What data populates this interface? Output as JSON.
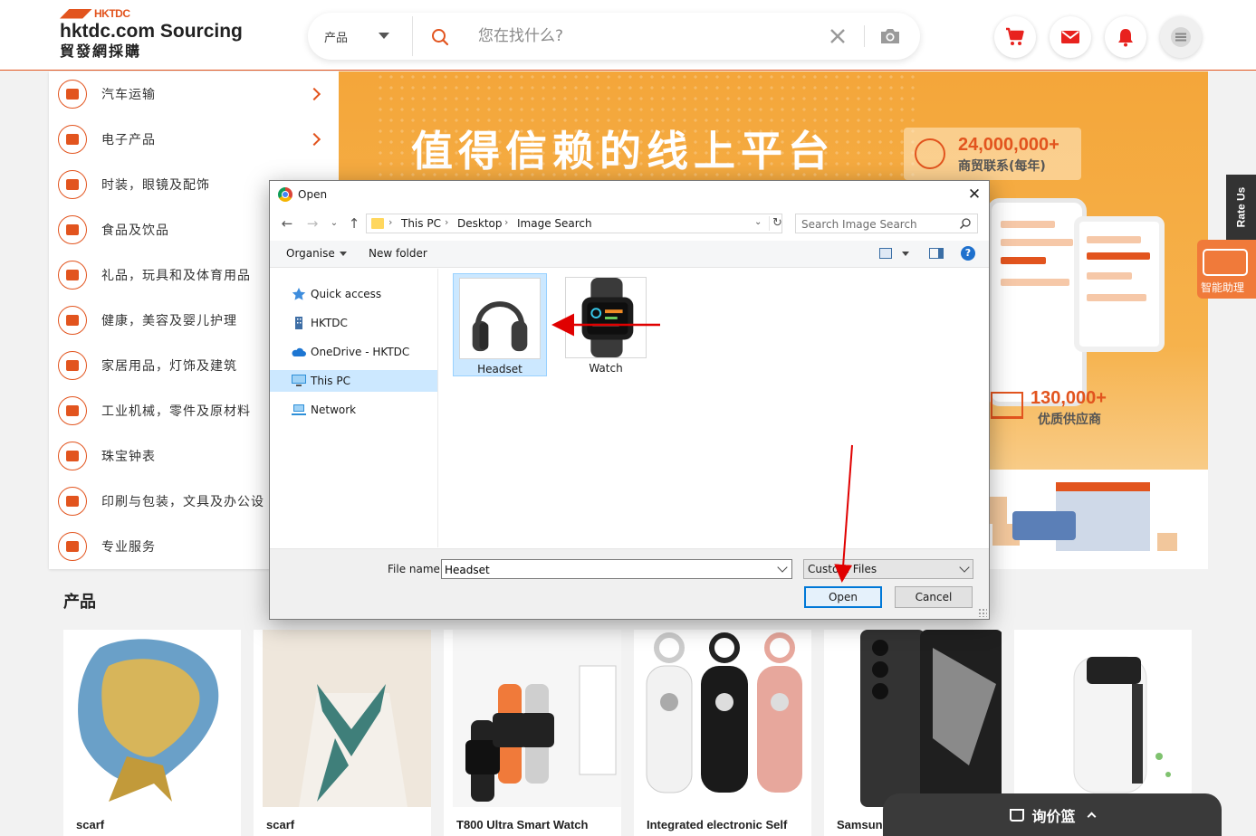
{
  "header": {
    "logo_brand": "HKTDC",
    "logo_title": "hktdc.com Sourcing",
    "logo_subtitle": "貿發網採購",
    "search": {
      "category": "产品",
      "placeholder": "您在找什么?"
    },
    "icons": [
      "cart-icon",
      "mail-icon",
      "bell-icon",
      "menu-icon"
    ]
  },
  "categories": [
    {
      "label": "汽车运输",
      "has_arrow": true
    },
    {
      "label": "电子产品",
      "has_arrow": true
    },
    {
      "label": "时装，眼镜及配饰",
      "has_arrow": true
    },
    {
      "label": "食品及饮品",
      "has_arrow": false
    },
    {
      "label": "礼品，玩具和及体育用品",
      "has_arrow": false
    },
    {
      "label": "健康，美容及婴儿护理",
      "has_arrow": false
    },
    {
      "label": "家居用品，灯饰及建筑",
      "has_arrow": false
    },
    {
      "label": "工业机械，零件及原材料",
      "has_arrow": false
    },
    {
      "label": "珠宝钟表",
      "has_arrow": false
    },
    {
      "label": "印刷与包装，文具及办公设",
      "has_arrow": false
    },
    {
      "label": "专业服务",
      "has_arrow": false
    }
  ],
  "banner": {
    "title": "值得信赖的线上平台",
    "stat1_value": "24,000,000+",
    "stat1_label": "商贸联系(每年)",
    "stat2_value": "130,000+",
    "stat2_label": "优质供应商"
  },
  "side_tabs": {
    "rate_us": "Rate Us",
    "ai_helper": "智能助理"
  },
  "products": {
    "title": "产品",
    "items": [
      {
        "name": "scarf"
      },
      {
        "name": "scarf"
      },
      {
        "name": "T800 Ultra Smart Watch"
      },
      {
        "name": "Integrated electronic Self"
      },
      {
        "name": "Samsun"
      },
      {
        "name": ""
      }
    ]
  },
  "inquiry_basket": {
    "label": "询价篮"
  },
  "dialog": {
    "title": "Open",
    "address": [
      "This PC",
      "Desktop",
      "Image Search"
    ],
    "search_placeholder": "Search Image Search",
    "toolbar": {
      "organise": "Organise",
      "new_folder": "New folder"
    },
    "nav": [
      {
        "label": "Quick access",
        "icon": "star-icon",
        "selected": false
      },
      {
        "label": "HKTDC",
        "icon": "building-icon",
        "selected": false
      },
      {
        "label": "OneDrive - HKTDC",
        "icon": "cloud-icon",
        "selected": false
      },
      {
        "label": "This PC",
        "icon": "monitor-icon",
        "selected": true
      },
      {
        "label": "Network",
        "icon": "network-icon",
        "selected": false
      }
    ],
    "files": [
      {
        "name": "Headset",
        "selected": true
      },
      {
        "name": "Watch",
        "selected": false
      }
    ],
    "file_name_label": "File name:",
    "file_name_value": "Headset",
    "file_type": "Custom Files",
    "open_label": "Open",
    "cancel_label": "Cancel"
  },
  "colors": {
    "brand": "#e2541e",
    "selection": "#cce8ff",
    "annotation": "#e00000"
  }
}
